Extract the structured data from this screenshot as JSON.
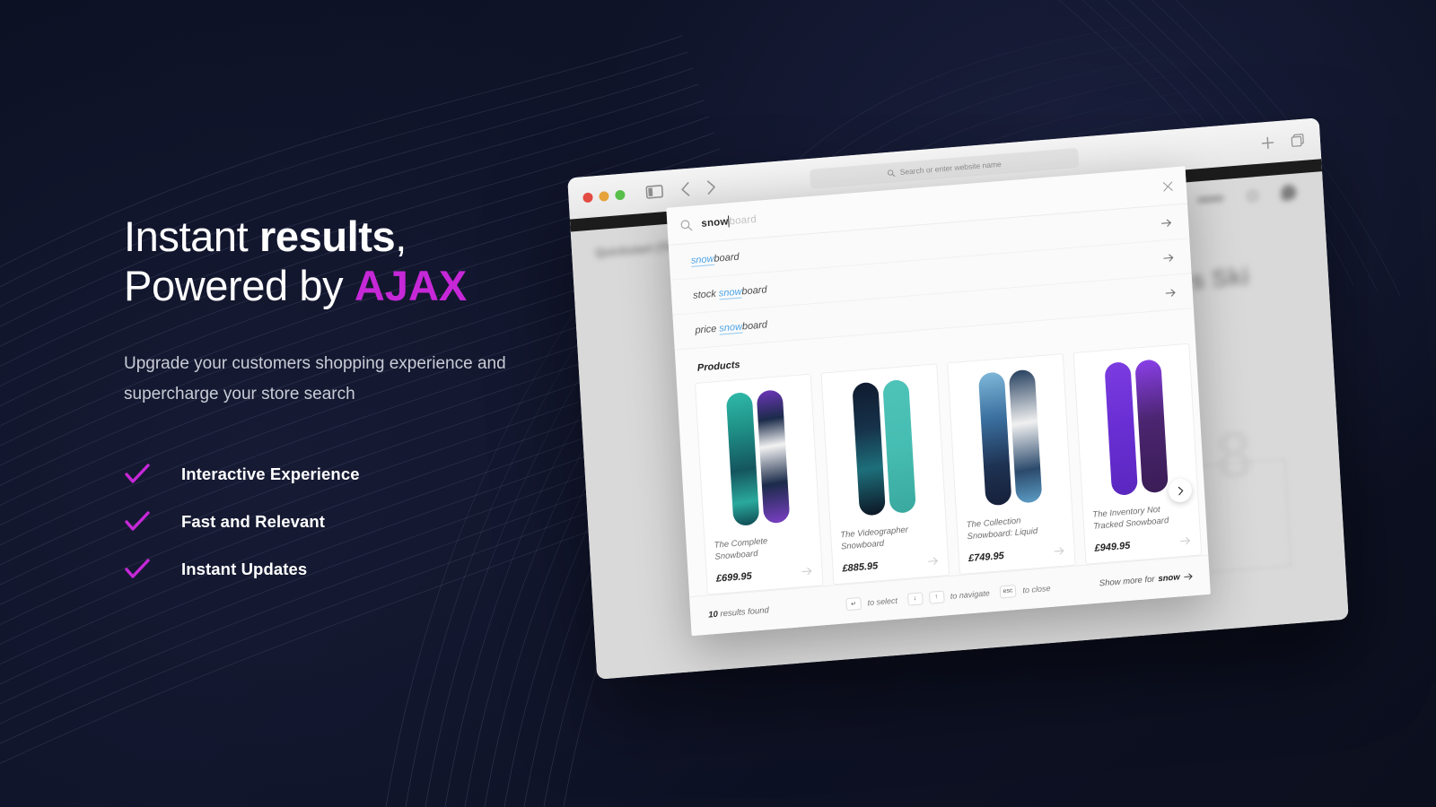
{
  "hero": {
    "headline_line1_plain": "Instant ",
    "headline_line1_strong": "results",
    "headline_line1_tail": ",",
    "headline_line2_plain": "Powered by ",
    "headline_line2_accent": "AJAX",
    "subtitle": "Upgrade your customers shopping experience and supercharge your store search",
    "accent_color": "#c628d8",
    "features": [
      {
        "label": "Interactive Experience"
      },
      {
        "label": "Fast and Relevant"
      },
      {
        "label": "Instant Updates"
      }
    ]
  },
  "browser": {
    "url_placeholder": "Search or enter website name",
    "traffic_lights": [
      "close",
      "minimize",
      "zoom"
    ],
    "icons": {
      "sidebar": "sidebar-icon",
      "back": "chevron-left-icon",
      "forward": "chevron-right-icon",
      "new_tab": "plus-icon",
      "tab_overview": "tab-overview-icon",
      "url_search": "search-icon"
    }
  },
  "page_behind": {
    "store_name": "Quickstart (The",
    "heading": "s Ski"
  },
  "overlay": {
    "query_typed": "snow",
    "query_ghost": "board",
    "close_label": "×",
    "suggestions": [
      {
        "prefix": "",
        "hit": "snow",
        "suffix": "board"
      },
      {
        "prefix": "stock ",
        "hit": "snow",
        "suffix": "board"
      },
      {
        "prefix": "price ",
        "hit": "snow",
        "suffix": "board"
      }
    ],
    "products_heading": "Products",
    "products": [
      {
        "title": "The Complete Snowboard",
        "price": "£699.95",
        "board_a": "linear-gradient(175deg,#2fb9a8 0%,#1f8f86 28%,#14555e 58%,#2aa99c 82%,#0f4a52 100%)",
        "board_b": "linear-gradient(175deg,#6c36b8 0%,#1b2b4a 22%,#f2f2f2 42%,#1b2b4a 70%,#7a3fc4 100%)"
      },
      {
        "title": "The Videographer Snowboard",
        "price": "£885.95",
        "board_a": "linear-gradient(175deg,#101a2e 0%,#16324a 35%,#1d6f7a 65%,#0d1524 100%)",
        "board_b": "linear-gradient(175deg,#4ec3b8 0%,#46bdb2 50%,#3aa99f 100%)"
      },
      {
        "title": "The Collection Snowboard: Liquid",
        "price": "£749.95",
        "board_a": "linear-gradient(175deg,#7fb7d9 0%,#3a6f9e 35%,#1e3252 70%,#16203a 100%)",
        "board_b": "linear-gradient(175deg,#26405f 0%,#f0f0f0 40%,#2b4a6c 75%,#5c9cc4 100%)"
      },
      {
        "title": "The Inventory Not Tracked Snowboard",
        "price": "£949.95",
        "board_a": "linear-gradient(175deg,#7b3ce0 0%,#6a2fd4 45%,#5a27c0 100%)",
        "board_b": "linear-gradient(175deg,#8a3fe8 0%,#4b2570 45%,#3a1d56 100%)"
      }
    ],
    "carousel_next_icon": "chevron-right-icon",
    "footer": {
      "results_count_number": "10",
      "results_count_text": " results found",
      "hint_select_key": "↵",
      "hint_select_text": "to select",
      "hint_nav_key_down": "↓",
      "hint_nav_key_up": "↑",
      "hint_nav_text": "to navigate",
      "hint_close_key": "esc",
      "hint_close_text": "to close",
      "show_more_prefix": "Show more for ",
      "show_more_term": "snow"
    }
  }
}
